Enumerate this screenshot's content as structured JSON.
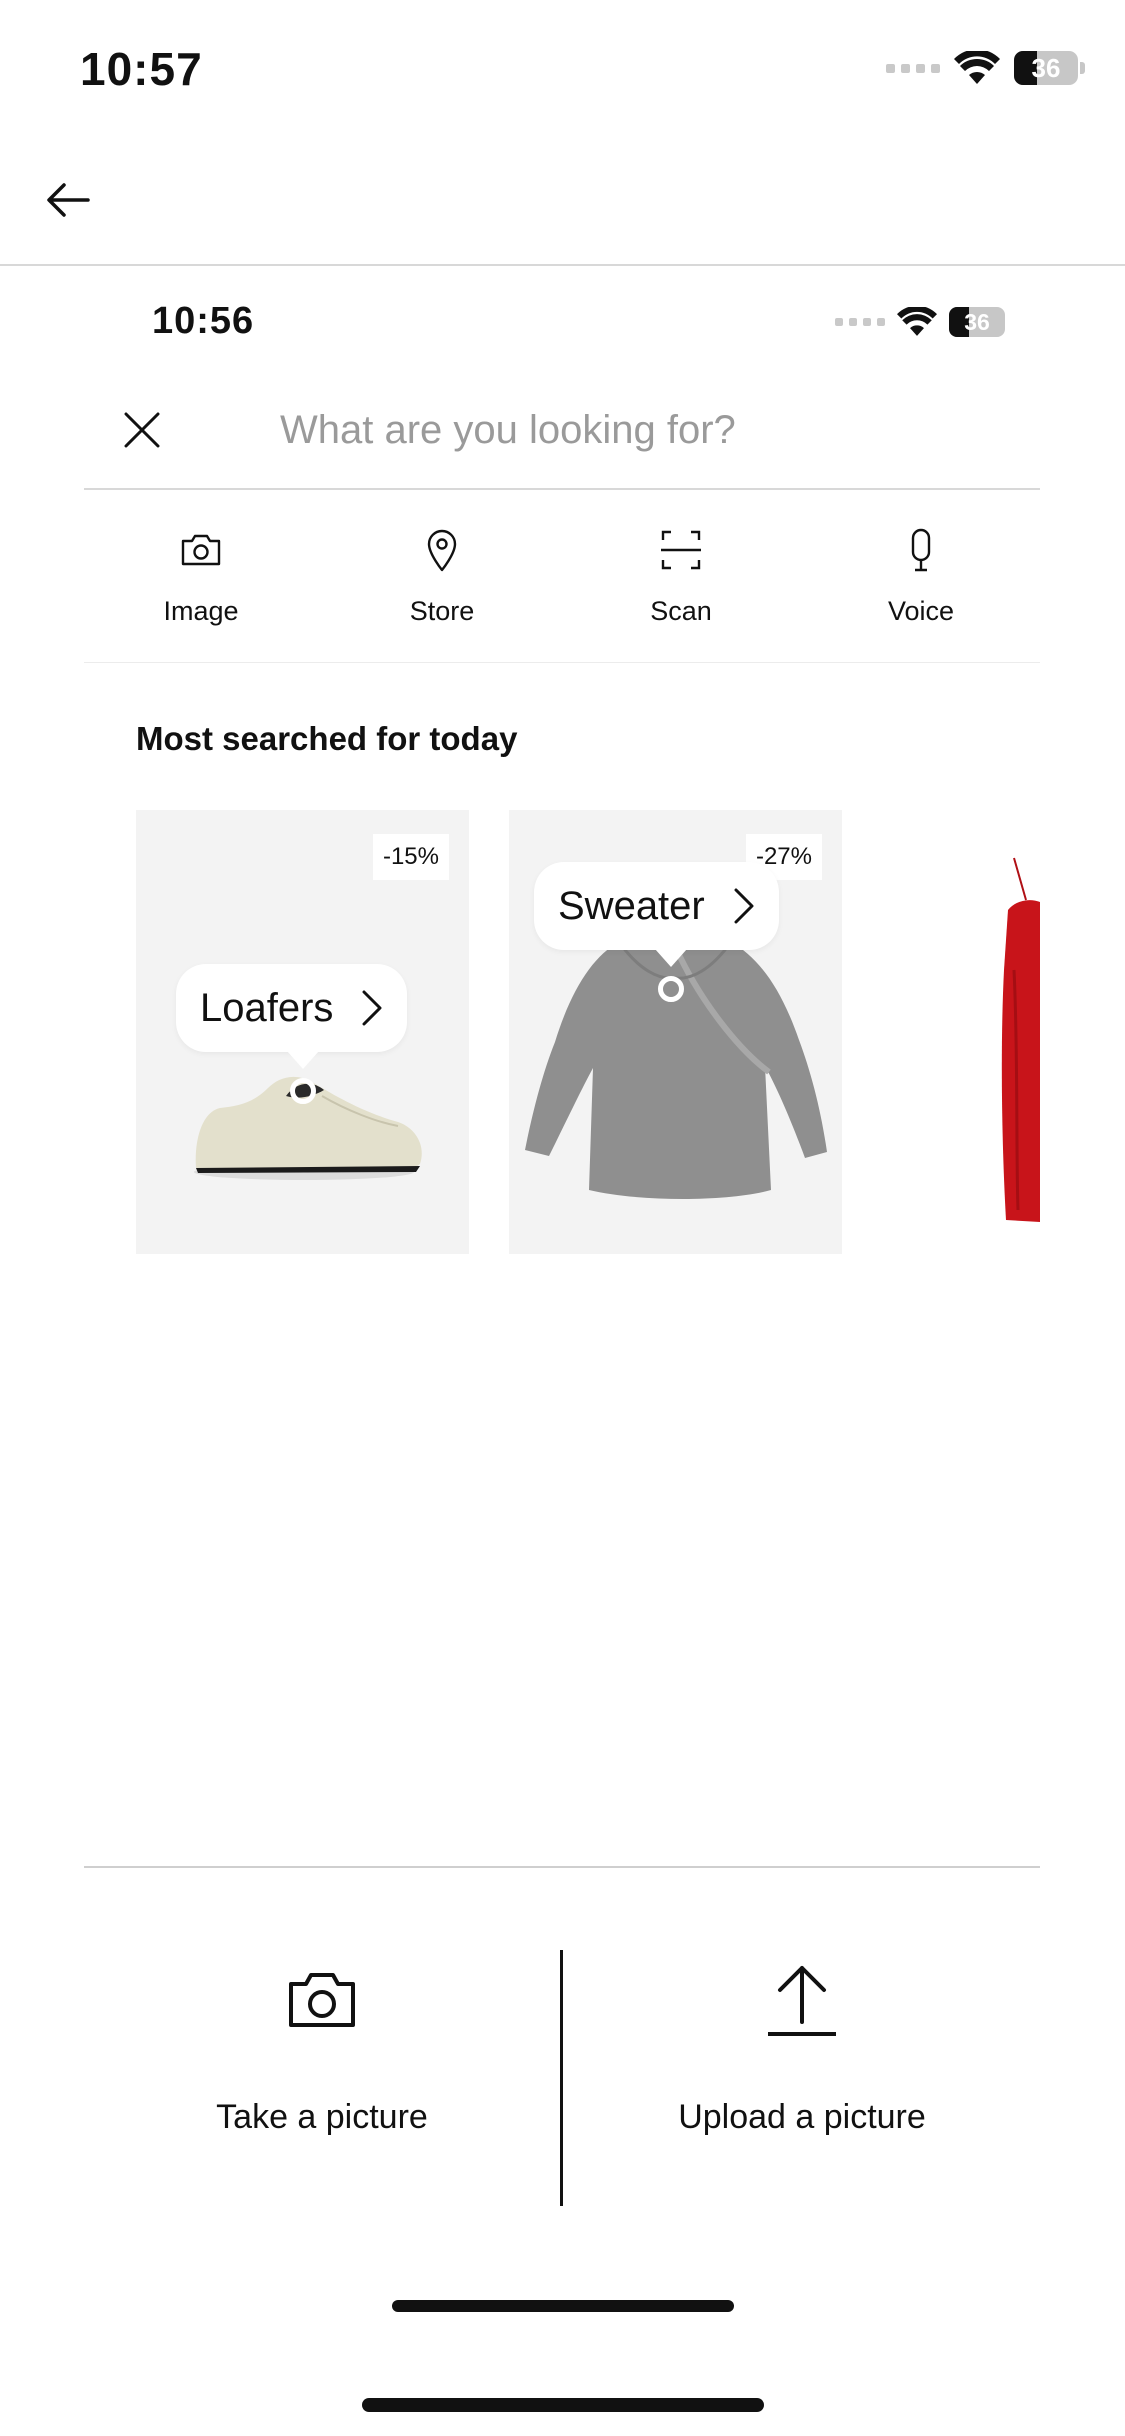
{
  "status_bar": {
    "time": "10:57",
    "battery": "36",
    "battery_level": 0.36
  },
  "header": {
    "back_icon": "arrow-left-icon"
  },
  "inner_status_bar": {
    "time": "10:56",
    "battery": "36",
    "battery_level": 0.36
  },
  "search": {
    "placeholder": "What are you looking for?",
    "value": "",
    "close_icon": "close-icon"
  },
  "search_modes": [
    {
      "label": "Image",
      "icon": "camera-icon"
    },
    {
      "label": "Store",
      "icon": "location-pin-icon"
    },
    {
      "label": "Scan",
      "icon": "scan-icon"
    },
    {
      "label": "Voice",
      "icon": "microphone-icon"
    }
  ],
  "most_searched": {
    "title": "Most searched for today",
    "items": [
      {
        "tag": "Loafers",
        "discount": "-15%"
      },
      {
        "tag": "Sweater",
        "discount": "-27%"
      }
    ]
  },
  "actions": {
    "take_picture": {
      "label": "Take a picture",
      "icon": "camera-icon"
    },
    "upload_picture": {
      "label": "Upload a picture",
      "icon": "upload-icon"
    }
  },
  "colors": {
    "accent": "#111111",
    "placeholder": "#9a9a9a",
    "dress_red": "#c8141a"
  }
}
